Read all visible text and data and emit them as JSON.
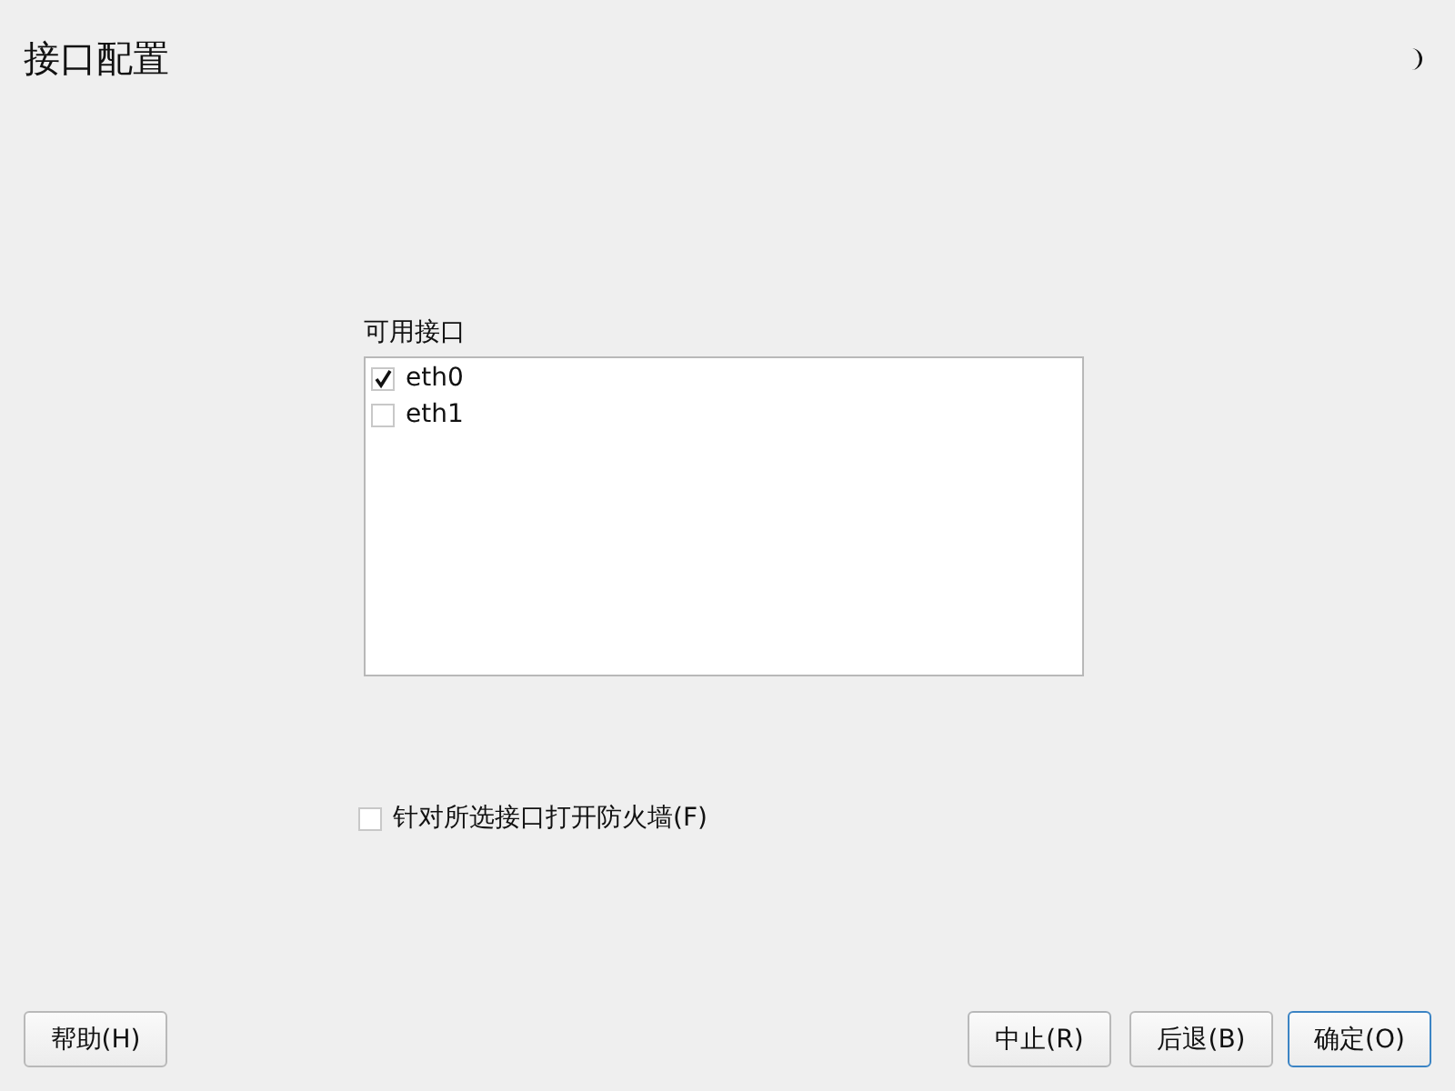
{
  "window": {
    "title": "接口配置"
  },
  "interfaces": {
    "label": "可用接口",
    "items": [
      {
        "name": "eth0",
        "checked": true
      },
      {
        "name": "eth1",
        "checked": false
      }
    ]
  },
  "firewall": {
    "label": "针对所选接口打开防火墙(F)",
    "checked": false
  },
  "buttons": [
    {
      "label": "帮助(H)",
      "focused": false
    },
    {
      "label": "中止(R)",
      "focused": false
    },
    {
      "label": "后退(B)",
      "focused": false
    },
    {
      "label": "确定(O)",
      "focused": true
    }
  ]
}
